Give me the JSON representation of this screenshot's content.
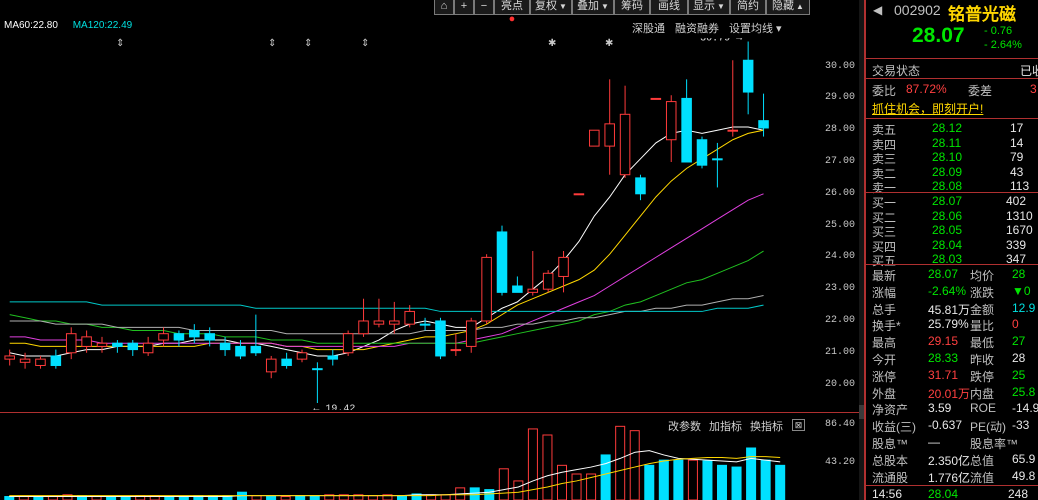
{
  "legend": {
    "ma60": "MA60:22.80",
    "ma120": "MA120:22.49"
  },
  "toolbar": {
    "buttons": [
      {
        "label": "亮点",
        "dot": "●"
      },
      {
        "label": "复权",
        "arrow": "▼"
      },
      {
        "label": "叠加",
        "arrow": "▼"
      },
      {
        "label": "筹码"
      },
      {
        "label": "画线"
      },
      {
        "label": "显示",
        "arrow": "▼"
      },
      {
        "label": "简约"
      },
      {
        "label": "隐藏",
        "arrow": "▲"
      }
    ]
  },
  "sub_tabs": [
    "深股通",
    "融资融券",
    "设置均线 ▾"
  ],
  "markers": {
    "up_down": "⇕",
    "star": "✱"
  },
  "chart_data": {
    "type": "candlestick",
    "y_ticks": [
      "30.00",
      "29.00",
      "28.00",
      "27.00",
      "26.00",
      "25.00",
      "24.00",
      "23.00",
      "22.00",
      "21.00",
      "20.00"
    ],
    "ylim": [
      19.2,
      30.9
    ],
    "annotations": {
      "high": "30.79",
      "low": "19.42"
    },
    "candles": [
      [
        20.9,
        20.8,
        21.1,
        20.6
      ],
      [
        20.7,
        20.8,
        21.0,
        20.5
      ],
      [
        20.8,
        20.6,
        20.9,
        20.5
      ],
      [
        20.6,
        20.9,
        21.1,
        20.5
      ],
      [
        21.0,
        21.6,
        21.8,
        20.8
      ],
      [
        21.5,
        21.2,
        21.7,
        21.0
      ],
      [
        21.3,
        21.2,
        21.5,
        21.0
      ],
      [
        21.2,
        21.3,
        21.4,
        21.0
      ],
      [
        21.3,
        21.1,
        21.4,
        20.9
      ],
      [
        21.0,
        21.3,
        21.5,
        20.9
      ],
      [
        21.4,
        21.6,
        21.8,
        21.2
      ],
      [
        21.6,
        21.4,
        21.7,
        21.2
      ],
      [
        21.5,
        21.7,
        21.9,
        21.3
      ],
      [
        21.6,
        21.4,
        21.8,
        21.2
      ],
      [
        21.3,
        21.1,
        21.5,
        20.9
      ],
      [
        21.2,
        20.9,
        21.4,
        20.8
      ],
      [
        21.0,
        21.2,
        22.2,
        20.9
      ],
      [
        20.4,
        20.8,
        20.9,
        20.2
      ],
      [
        20.8,
        20.6,
        21.0,
        20.5
      ],
      [
        20.8,
        21.0,
        21.1,
        20.7
      ],
      [
        20.5,
        20.5,
        20.7,
        19.42
      ],
      [
        20.8,
        20.9,
        21.1,
        20.6
      ],
      [
        21.0,
        21.6,
        21.7,
        20.9
      ],
      [
        21.6,
        22.0,
        22.7,
        21.5
      ],
      [
        21.9,
        22.0,
        22.7,
        21.8
      ],
      [
        22.0,
        21.9,
        22.6,
        21.6
      ],
      [
        22.3,
        21.9,
        22.5,
        21.8
      ],
      [
        21.9,
        21.9,
        22.1,
        21.7
      ],
      [
        22.0,
        20.9,
        22.1,
        20.8
      ],
      [
        21.1,
        21.1,
        21.6,
        20.9
      ],
      [
        21.2,
        22.0,
        22.1,
        21.0
      ],
      [
        22.0,
        24.0,
        24.1,
        21.9
      ],
      [
        24.8,
        22.9,
        25.0,
        22.8
      ],
      [
        23.1,
        22.9,
        23.4,
        22.9
      ],
      [
        22.9,
        23.0,
        24.2,
        22.8
      ],
      [
        23.0,
        23.5,
        23.6,
        22.9
      ],
      [
        23.4,
        24.0,
        24.2,
        22.9
      ],
      [
        26.0,
        26.0,
        26.0,
        26.0
      ],
      [
        27.5,
        28.0,
        28.0,
        27.5
      ],
      [
        27.5,
        28.2,
        29.6,
        26.6
      ],
      [
        26.6,
        28.5,
        29.4,
        26.5
      ],
      [
        26.5,
        26.0,
        26.6,
        25.8
      ],
      [
        29.0,
        29.0,
        29.0,
        29.0
      ],
      [
        28.9,
        27.7,
        29.1,
        27.0
      ],
      [
        27.0,
        29.0,
        29.6,
        27.0
      ],
      [
        27.7,
        26.9,
        27.8,
        26.8
      ],
      [
        27.1,
        27.1,
        27.6,
        26.2
      ],
      [
        28.0,
        28.0,
        30.2,
        27.8
      ],
      [
        30.2,
        29.2,
        30.79,
        28.5
      ],
      [
        28.3,
        28.07,
        29.15,
        27.8
      ]
    ],
    "candle_colors": [
      "r",
      "r",
      "r",
      "c",
      "r",
      "r",
      "r",
      "c",
      "c",
      "r",
      "r",
      "c",
      "c",
      "c",
      "c",
      "c",
      "c",
      "r",
      "c",
      "r",
      "c",
      "c",
      "r",
      "r",
      "r",
      "r",
      "r",
      "c",
      "c",
      "r",
      "r",
      "r",
      "c",
      "c",
      "r",
      "r",
      "r",
      "r",
      "r",
      "r",
      "r",
      "c",
      "r",
      "r",
      "c",
      "c",
      "c",
      "r",
      "c",
      "c"
    ],
    "ma_series": [
      {
        "color": "#ffffff",
        "values": [
          21.0,
          20.9,
          20.9,
          20.9,
          21.0,
          21.1,
          21.1,
          21.2,
          21.2,
          21.2,
          21.3,
          21.3,
          21.4,
          21.4,
          21.4,
          21.3,
          21.3,
          21.2,
          21.1,
          21.0,
          20.9,
          20.9,
          21.0,
          21.2,
          21.4,
          21.7,
          21.9,
          22.0,
          21.9,
          21.8,
          21.8,
          22.1,
          22.4,
          22.6,
          23.0,
          23.4,
          23.9,
          24.5,
          25.3,
          25.9,
          26.6,
          27.1,
          27.6,
          27.9,
          28.0,
          27.9,
          28.0,
          28.1,
          28.1,
          28.0
        ]
      },
      {
        "color": "#ffd700",
        "values": [
          21.3,
          21.3,
          21.2,
          21.2,
          21.2,
          21.2,
          21.2,
          21.2,
          21.2,
          21.2,
          21.2,
          21.2,
          21.2,
          21.3,
          21.3,
          21.3,
          21.3,
          21.3,
          21.2,
          21.2,
          21.1,
          21.1,
          21.1,
          21.1,
          21.2,
          21.3,
          21.4,
          21.5,
          21.5,
          21.6,
          21.7,
          21.9,
          22.2,
          22.5,
          22.7,
          22.9,
          23.1,
          23.3,
          23.6,
          24.1,
          24.7,
          25.3,
          25.9,
          26.4,
          26.8,
          27.1,
          27.4,
          27.7,
          27.9,
          28.0
        ]
      },
      {
        "color": "#e040e0",
        "values": [
          21.5,
          21.5,
          21.4,
          21.4,
          21.4,
          21.4,
          21.3,
          21.3,
          21.3,
          21.3,
          21.3,
          21.3,
          21.3,
          21.3,
          21.3,
          21.3,
          21.3,
          21.3,
          21.2,
          21.2,
          21.2,
          21.2,
          21.2,
          21.2,
          21.2,
          21.2,
          21.3,
          21.3,
          21.3,
          21.3,
          21.4,
          21.5,
          21.6,
          21.8,
          22.0,
          22.2,
          22.4,
          22.6,
          22.8,
          23.1,
          23.4,
          23.7,
          24.0,
          24.3,
          24.6,
          24.9,
          25.2,
          25.5,
          25.8,
          26.0
        ]
      },
      {
        "color": "#20c020",
        "values": [
          22.2,
          22.1,
          22.0,
          22.0,
          21.9,
          21.9,
          21.8,
          21.8,
          21.7,
          21.7,
          21.7,
          21.6,
          21.6,
          21.6,
          21.5,
          21.5,
          21.5,
          21.4,
          21.4,
          21.4,
          21.3,
          21.3,
          21.3,
          21.3,
          21.3,
          21.3,
          21.3,
          21.3,
          21.3,
          21.3,
          21.3,
          21.4,
          21.5,
          21.6,
          21.7,
          21.8,
          21.9,
          22.0,
          22.2,
          22.3,
          22.5,
          22.6,
          22.8,
          23.0,
          23.2,
          23.3,
          23.5,
          23.7,
          23.9,
          24.2
        ]
      },
      {
        "color": "#b0b0b0",
        "values": [
          22.0,
          22.0,
          22.0,
          21.9,
          21.9,
          21.9,
          21.9,
          21.8,
          21.8,
          21.8,
          21.8,
          21.8,
          21.7,
          21.7,
          21.7,
          21.7,
          21.7,
          21.7,
          21.6,
          21.6,
          21.6,
          21.6,
          21.6,
          21.6,
          21.6,
          21.6,
          21.6,
          21.7,
          21.7,
          21.7,
          21.7,
          21.8,
          21.8,
          21.9,
          21.9,
          22.0,
          22.0,
          22.1,
          22.1,
          22.2,
          22.3,
          22.3,
          22.4,
          22.4,
          22.5,
          22.5,
          22.6,
          22.7,
          22.7,
          22.8
        ]
      },
      {
        "color": "#00c8c8",
        "values": [
          22.6,
          22.6,
          22.6,
          22.6,
          22.6,
          22.6,
          22.5,
          22.5,
          22.5,
          22.5,
          22.5,
          22.5,
          22.5,
          22.5,
          22.5,
          22.5,
          22.4,
          22.4,
          22.4,
          22.4,
          22.4,
          22.4,
          22.4,
          22.4,
          22.4,
          22.4,
          22.4,
          22.4,
          22.3,
          22.3,
          22.3,
          22.3,
          22.3,
          22.3,
          22.3,
          22.3,
          22.3,
          22.3,
          22.3,
          22.3,
          22.3,
          22.3,
          22.3,
          22.3,
          22.3,
          22.3,
          22.4,
          22.4,
          22.4,
          22.5
        ]
      }
    ],
    "volume": {
      "y_ticks": [
        "86.40",
        "43.20"
      ],
      "ylim": [
        0,
        90
      ],
      "values": [
        4,
        4,
        3,
        4,
        6,
        5,
        4,
        4,
        4,
        5,
        5,
        4,
        4,
        5,
        5,
        5,
        9,
        5,
        4,
        4,
        5,
        5,
        6,
        6,
        6,
        5,
        6,
        5,
        7,
        6,
        6,
        14,
        14,
        12,
        36,
        22,
        82,
        75,
        40,
        30,
        30,
        52,
        85,
        80,
        40,
        46,
        46,
        46,
        45,
        40,
        38,
        60,
        46,
        40
      ],
      "colors": [
        "c",
        "r",
        "c",
        "r",
        "r",
        "c",
        "r",
        "c",
        "c",
        "r",
        "r",
        "c",
        "c",
        "c",
        "c",
        "c",
        "c",
        "r",
        "c",
        "r",
        "c",
        "c",
        "r",
        "r",
        "r",
        "r",
        "r",
        "c",
        "c",
        "r",
        "r",
        "r",
        "c",
        "c",
        "r",
        "r",
        "r",
        "r",
        "r",
        "r",
        "r",
        "c",
        "r",
        "r",
        "c",
        "c",
        "c",
        "r",
        "c",
        "c",
        "c",
        "c",
        "c",
        "c"
      ],
      "ma_lines": [
        {
          "color": "#ffffff",
          "values": [
            4,
            4,
            4,
            4,
            4,
            4,
            4,
            4,
            4,
            4,
            4,
            4,
            4,
            4,
            4,
            4,
            5,
            5,
            5,
            5,
            5,
            5,
            5,
            5,
            5,
            5,
            5,
            5,
            6,
            6,
            6,
            7,
            8,
            9,
            12,
            15,
            22,
            28,
            32,
            35,
            38,
            42,
            48,
            55,
            57,
            52,
            48,
            47,
            46,
            45,
            44,
            48,
            46,
            44
          ]
        },
        {
          "color": "#ffd700",
          "values": [
            5,
            5,
            5,
            5,
            5,
            5,
            5,
            5,
            5,
            5,
            5,
            5,
            5,
            5,
            5,
            5,
            5,
            5,
            5,
            5,
            5,
            5,
            5,
            5,
            5,
            5,
            5,
            5,
            5,
            5,
            6,
            6,
            6,
            7,
            8,
            9,
            12,
            15,
            19,
            22,
            26,
            30,
            34,
            38,
            42,
            45,
            47,
            48,
            49,
            49,
            48,
            50,
            50,
            49
          ]
        }
      ]
    }
  },
  "indicator_tabs": [
    "改参数",
    "加指标",
    "换指标"
  ],
  "indicator_close": "⊠",
  "quote": {
    "arrow": "◀",
    "code": "002902",
    "name": "铭普光磁",
    "price": "28.07",
    "change": "- 0.76",
    "change_pct": "- 2.64%",
    "status_label": "交易状态",
    "status_value": "已收",
    "weibi_label": "委比",
    "weibi_value": "87.72%",
    "weicha_label": "委差",
    "weicha_value": "3",
    "promo": "抓住机会，即刻开户!",
    "sells": [
      {
        "label": "卖五",
        "price": "28.12",
        "vol": "17"
      },
      {
        "label": "卖四",
        "price": "28.11",
        "vol": "14"
      },
      {
        "label": "卖三",
        "price": "28.10",
        "vol": "79"
      },
      {
        "label": "卖二",
        "price": "28.09",
        "vol": "43"
      },
      {
        "label": "卖一",
        "price": "28.08",
        "vol": "113"
      }
    ],
    "buys": [
      {
        "label": "买一",
        "price": "28.07",
        "vol": "402"
      },
      {
        "label": "买二",
        "price": "28.06",
        "vol": "1310"
      },
      {
        "label": "买三",
        "price": "28.05",
        "vol": "1670"
      },
      {
        "label": "买四",
        "price": "28.04",
        "vol": "339"
      },
      {
        "label": "买五",
        "price": "28.03",
        "vol": "347"
      }
    ],
    "stats": [
      {
        "l1": "最新",
        "v1": "28.07",
        "c1": "green",
        "l2": "均价",
        "v2": "28",
        "c2": "green"
      },
      {
        "l1": "涨幅",
        "v1": "-2.64%",
        "c1": "green",
        "l2": "涨跌",
        "v2": "▼0",
        "c2": "green"
      },
      {
        "l1": "总手",
        "v1": "45.81万",
        "c1": "white",
        "l2": "金额",
        "v2": "12.9",
        "c2": "cyan"
      },
      {
        "l1": "换手*",
        "v1": "25.79%",
        "c1": "white",
        "l2": "量比",
        "v2": "0",
        "c2": "red"
      },
      {
        "l1": "最高",
        "v1": "29.15",
        "c1": "red",
        "l2": "最低",
        "v2": "27",
        "c2": "green"
      },
      {
        "l1": "今开",
        "v1": "28.33",
        "c1": "green",
        "l2": "昨收",
        "v2": "28",
        "c2": "white"
      },
      {
        "l1": "涨停",
        "v1": "31.71",
        "c1": "red",
        "l2": "跌停",
        "v2": "25",
        "c2": "green"
      },
      {
        "l1": "外盘",
        "v1": "20.01万",
        "c1": "red",
        "l2": "内盘",
        "v2": "25.8",
        "c2": "green"
      },
      {
        "l1": "净资产",
        "v1": "3.59",
        "c1": "white",
        "l2": "ROE",
        "v2": "-14.9",
        "c2": "white"
      },
      {
        "l1": "收益(三)",
        "v1": "-0.637",
        "c1": "white",
        "l2": "PE(动)",
        "v2": "-33",
        "c2": "white"
      },
      {
        "l1": "股息™",
        "v1": "—",
        "c1": "white",
        "l2": "股息率™",
        "v2": "",
        "c2": "white"
      },
      {
        "l1": "总股本",
        "v1": "2.350亿",
        "c1": "white",
        "l2": "总值",
        "v2": "65.9",
        "c2": "white"
      },
      {
        "l1": "流通股",
        "v1": "1.776亿",
        "c1": "white",
        "l2": "流值",
        "v2": "49.8",
        "c2": "white"
      }
    ],
    "tick": {
      "time": "14:56",
      "price": "28.04",
      "vol": "248"
    }
  }
}
